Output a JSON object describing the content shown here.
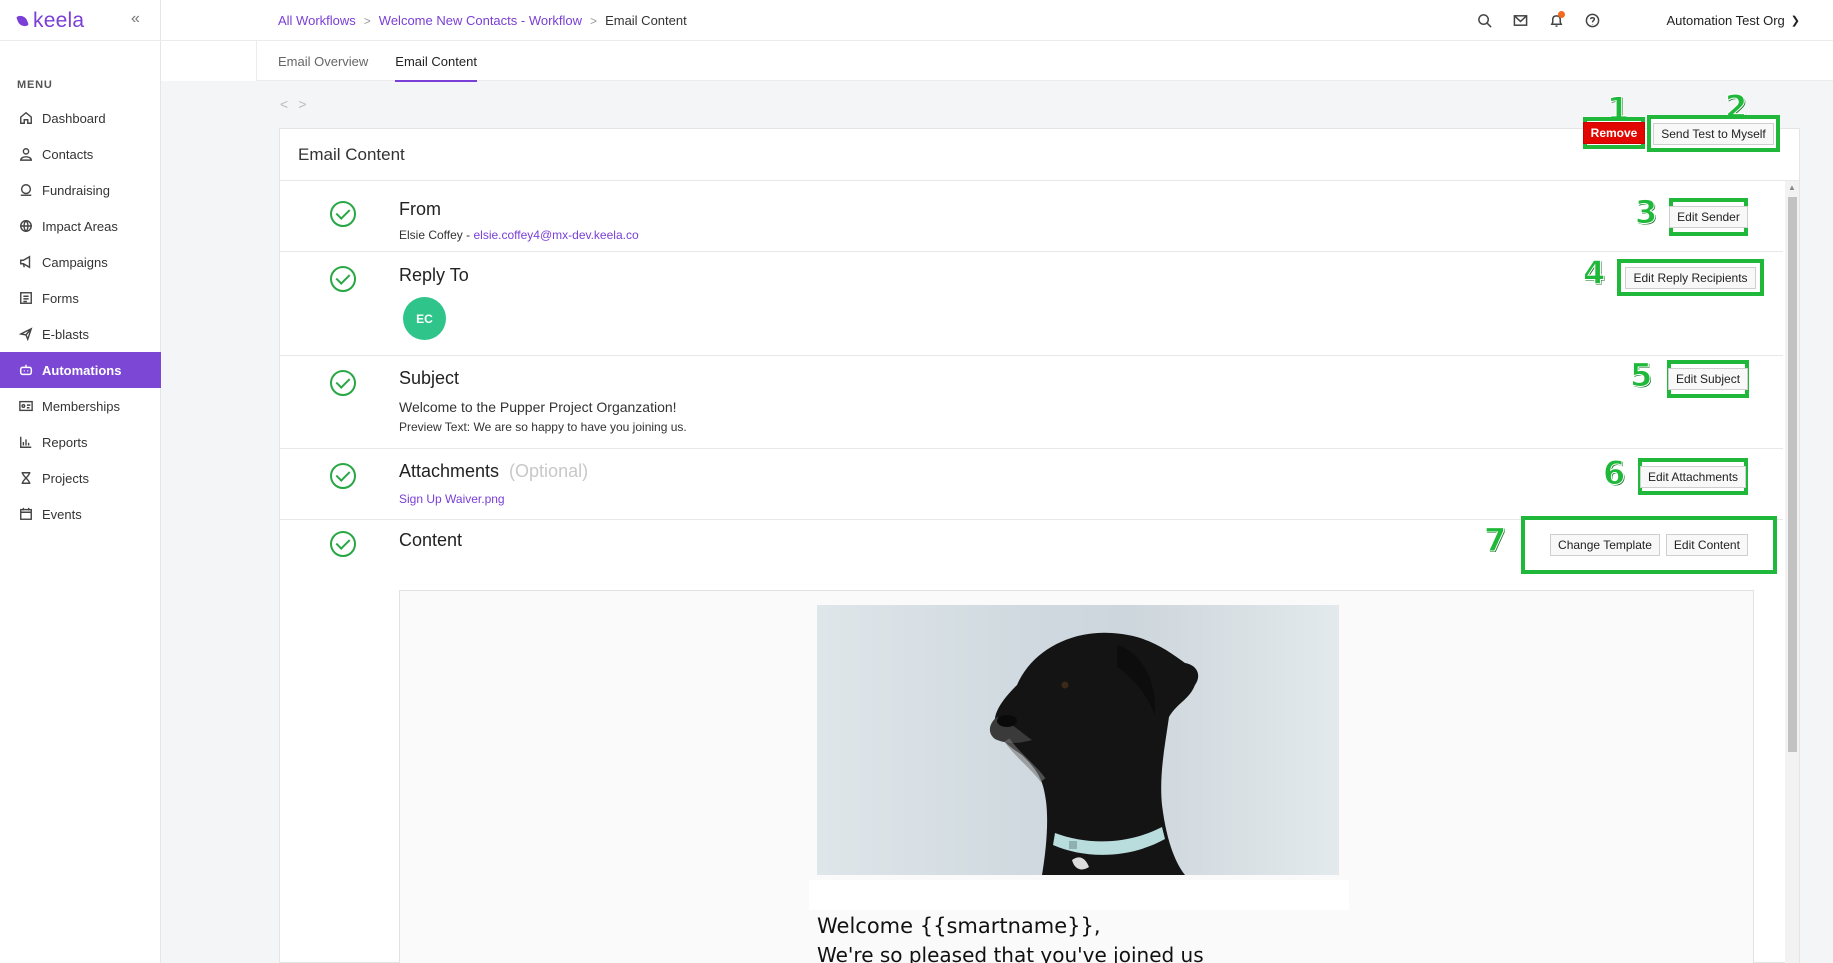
{
  "app": {
    "logo_text": "keela",
    "collapse_icon": "«"
  },
  "sidebar": {
    "menu_label": "MENU",
    "items": [
      {
        "label": "Dashboard",
        "icon": "home-icon"
      },
      {
        "label": "Contacts",
        "icon": "user-icon"
      },
      {
        "label": "Fundraising",
        "icon": "donation-icon"
      },
      {
        "label": "Impact Areas",
        "icon": "globe-icon"
      },
      {
        "label": "Campaigns",
        "icon": "megaphone-icon"
      },
      {
        "label": "Forms",
        "icon": "form-icon"
      },
      {
        "label": "E-blasts",
        "icon": "send-icon"
      },
      {
        "label": "Automations",
        "icon": "robot-icon",
        "active": true
      },
      {
        "label": "Memberships",
        "icon": "id-card-icon"
      },
      {
        "label": "Reports",
        "icon": "chart-icon"
      },
      {
        "label": "Projects",
        "icon": "hourglass-icon"
      },
      {
        "label": "Events",
        "icon": "calendar-icon"
      }
    ]
  },
  "breadcrumb": {
    "items": [
      "All Workflows",
      "Welcome New Contacts - Workflow"
    ],
    "current": "Email Content",
    "separator": ">"
  },
  "header": {
    "org_name": "Automation Test Org"
  },
  "tabs": [
    {
      "label": "Email Overview",
      "active": false
    },
    {
      "label": "Email Content",
      "active": true
    }
  ],
  "pager": {
    "prev": "<",
    "next": ">"
  },
  "card": {
    "title": "Email Content",
    "remove_label": "Remove",
    "send_test_label": "Send Test to Myself"
  },
  "annotations": [
    "1",
    "2",
    "3",
    "4",
    "5",
    "6",
    "7"
  ],
  "sections": {
    "from": {
      "title": "From",
      "name": "Elsie Coffey - ",
      "email": "elsie.coffey4@mx-dev.keela.co",
      "button": "Edit Sender"
    },
    "reply_to": {
      "title": "Reply To",
      "avatar_initials": "EC",
      "button": "Edit Reply Recipients"
    },
    "subject": {
      "title": "Subject",
      "subject_text": "Welcome to the Pupper Project Organzation!",
      "preview_text": "Preview Text: We are so happy to have you joining us.",
      "button": "Edit Subject"
    },
    "attachments": {
      "title": "Attachments",
      "optional": "(Optional)",
      "file": "Sign Up Waiver.png",
      "button": "Edit Attachments"
    },
    "content": {
      "title": "Content",
      "change_template": "Change Template",
      "edit_content": "Edit Content"
    }
  },
  "email_preview": {
    "heading": "Welcome {{smartname}},",
    "body": "We're so pleased that you've joined us"
  },
  "colors": {
    "accent": "#7a3fd6",
    "annotation_green": "#1fb83a",
    "check_green": "#28a745",
    "remove_red": "#e10600",
    "avatar": "#2fc58a"
  }
}
